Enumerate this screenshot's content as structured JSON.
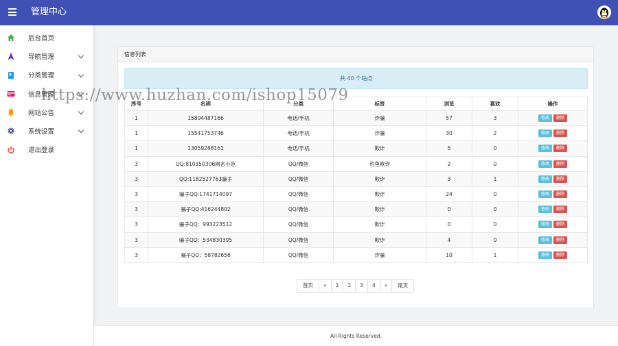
{
  "header": {
    "title": "管理中心"
  },
  "sidebar": {
    "items": [
      {
        "label": "后台首页",
        "icon": "home-icon",
        "color": "#4caf50",
        "has_chevron": false
      },
      {
        "label": "导航管理",
        "icon": "navigation-icon",
        "color": "#673ab7",
        "has_chevron": true
      },
      {
        "label": "分类管理",
        "icon": "book-icon",
        "color": "#2196f3",
        "has_chevron": true
      },
      {
        "label": "信息管理",
        "icon": "card-icon",
        "color": "#e91e63",
        "has_chevron": true
      },
      {
        "label": "网站公告",
        "icon": "bell-icon",
        "color": "#ff9800",
        "has_chevron": true
      },
      {
        "label": "系统设置",
        "icon": "gear-icon",
        "color": "#3f51b5",
        "has_chevron": true
      },
      {
        "label": "退出登录",
        "icon": "power-icon",
        "color": "#f44336",
        "has_chevron": false
      }
    ]
  },
  "panel": {
    "title": "信息列表",
    "alert": "共 40 个站点",
    "columns": [
      "序号",
      "名称",
      "分类",
      "标签",
      "浏览",
      "喜欢",
      "操作"
    ],
    "edit_label": "修改",
    "delete_label": "删除",
    "rows": [
      [
        "1",
        "15804487166",
        "电话/手机",
        "诈骗",
        "57",
        "3"
      ],
      [
        "1",
        "15541753746",
        "电话/手机",
        "诈骗",
        "30",
        "2"
      ],
      [
        "1",
        "13059288161",
        "电话/手机",
        "欺诈",
        "5",
        "0"
      ],
      [
        "3",
        "QQ:810350306网名小范",
        "QQ/微信",
        "钓鱼欺诈",
        "2",
        "0"
      ],
      [
        "3",
        "QQ:1182527763骗子",
        "QQ/微信",
        "欺诈",
        "3",
        "1"
      ],
      [
        "3",
        "骗子QQ:1741714097",
        "QQ/微信",
        "欺诈",
        "24",
        "0"
      ],
      [
        "3",
        "骗子QQ:416244802",
        "QQ/微信",
        "欺诈",
        "0",
        "0"
      ],
      [
        "3",
        "骗子QQ：993223512",
        "QQ/微信",
        "欺诈",
        "0",
        "0"
      ],
      [
        "3",
        "骗子QQ：534830395",
        "QQ/微信",
        "欺诈",
        "4",
        "0"
      ],
      [
        "3",
        "骗子QQ：58782656",
        "QQ/微信",
        "诈骗",
        "10",
        "1"
      ]
    ]
  },
  "pagination": [
    "首页",
    "«",
    "1",
    "2",
    "3",
    "4",
    "»",
    "尾页"
  ],
  "footer": {
    "text": "All Rights Reserved."
  },
  "watermark": "https://www.huzhan.com/ishop15079",
  "colors": {
    "topbar": "#3f51b5",
    "alert_bg": "#d9edf7",
    "edit": "#5bc0de",
    "delete": "#d9534f"
  }
}
